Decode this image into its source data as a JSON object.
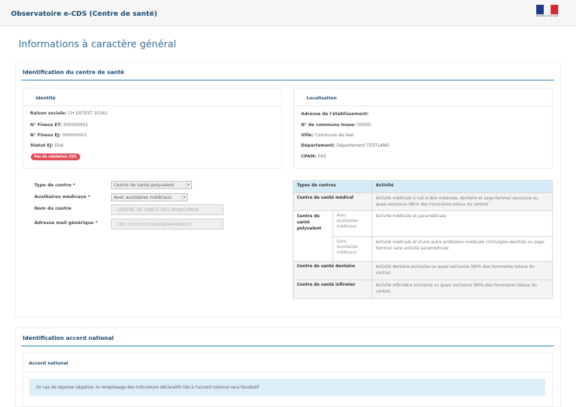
{
  "header": {
    "app_title": "Observatoire e-CDS (Centre de santé)",
    "logo_text": "République Française"
  },
  "page": {
    "title": "Informations à caractère général"
  },
  "section_identification": {
    "title": "Identification du centre de santé",
    "identite": {
      "title": "Identité",
      "rows": [
        {
          "label": "Raison sociale",
          "value": "CH DETEST 20181"
        },
        {
          "label": "N° Finess ET",
          "value": "000000001"
        },
        {
          "label": "N° Finess EJ",
          "value": "000000001"
        },
        {
          "label": "Statut EJ",
          "value": "Etat"
        }
      ],
      "badge": "Pas de validation CDS"
    },
    "localisation": {
      "title": "Localisation",
      "rows": [
        {
          "label": "Adresse de l'établissement",
          "value": ""
        },
        {
          "label": "N° de commune Insee",
          "value": "00000"
        },
        {
          "label": "Ville",
          "value": "Commune de test"
        },
        {
          "label": "Département",
          "value": "Département TESTLAND"
        },
        {
          "label": "CPAM",
          "value": "000"
        }
      ]
    },
    "form": {
      "type_centre": {
        "label": "Type de centre *",
        "value": "Centre de santé polyvalent"
      },
      "auxiliaires": {
        "label": "Auxiliaires médicaux *",
        "value": "Avec auxiliaires médicaux"
      },
      "nom": {
        "label": "Nom du centre",
        "value": "CENTRE DE SANTE DES MUNICIPAUX"
      },
      "mail": {
        "label": "Adresse mail générique *",
        "value": "cds.mut.municipaux@wanadoo.fr"
      }
    },
    "types_table": {
      "headers": [
        "Types de centres",
        "Activité"
      ],
      "rows": [
        {
          "type": "Centre de santé médical",
          "activity": "Activité médicale (c'est-à-dire médicale, dentaire et sage-femme) exclusive ou quasi exclusive (80% des honoraires totaux du centre)"
        },
        {
          "type": "Centre de santé polyvalent",
          "sub": "Avec auxiliaires médicaux",
          "activity": "Activité médicale et paramédicale"
        },
        {
          "sub": "Sans auxiliaires médicaux",
          "activity": "Activité médicale et d'une autre profession médicale (chirurgien-dentiste ou sage-femme) sans activité paramédicale"
        },
        {
          "type": "Centre de santé dentaire",
          "activity": "Activité dentaire exclusive ou quasi exclusive (80% des honoraires totaux du centre)"
        },
        {
          "type": "Centre de santé infirmier",
          "activity": "Activité infirmière exclusive ou quasi exclusive (80% des honoraires totaux du centre)"
        }
      ]
    }
  },
  "section_accord": {
    "title": "Identification accord national",
    "card_title": "Accord national",
    "notice": "En cas de réponse négative, le remplissage des indicateurs déclaratifs liés à l'accord national sera facultatif"
  }
}
